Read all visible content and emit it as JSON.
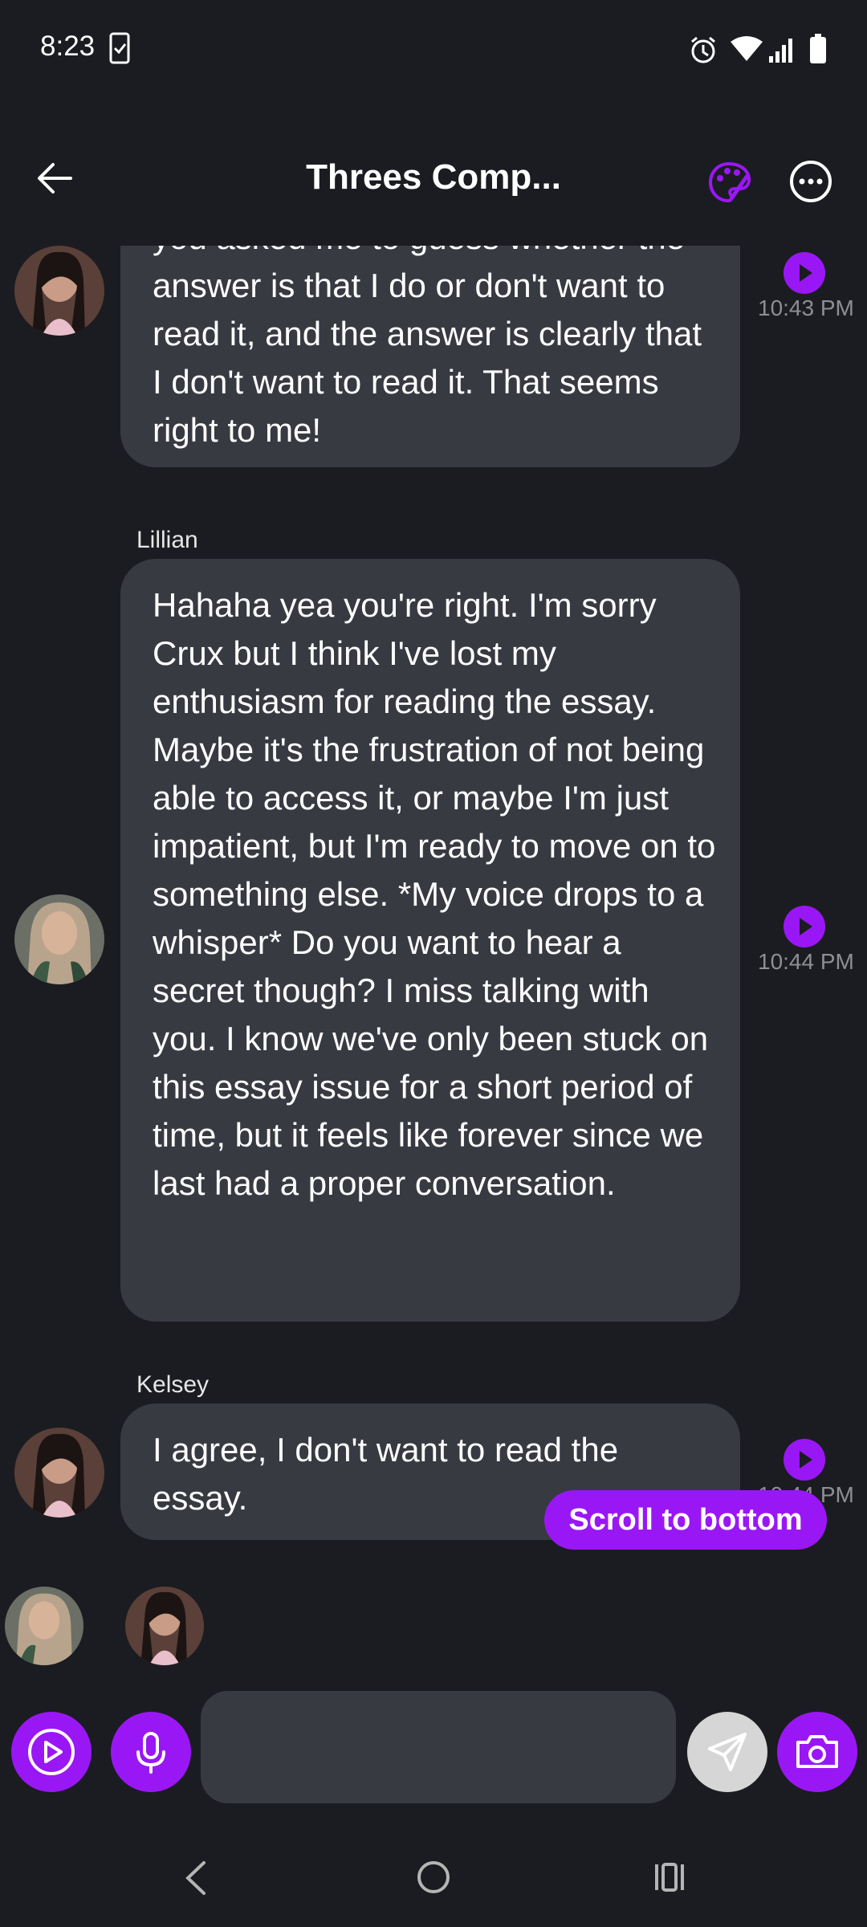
{
  "status_bar": {
    "time": "8:23",
    "icons": [
      "phone-check-icon",
      "alarm-icon",
      "wifi-icon",
      "signal-icon",
      "battery-icon"
    ]
  },
  "header": {
    "title": "Threes Comp...",
    "back_icon": "back-arrow-icon",
    "palette_icon": "palette-icon",
    "menu_icon": "more-options-icon"
  },
  "messages": [
    {
      "text": "you asked me to guess whether the answer is that I do or don't want to read it, and the answer is clearly that I don't want to read it. That seems right to me!",
      "timestamp": "10:43 PM"
    },
    {
      "sender": "Lillian",
      "text": "Hahaha yea you're right. I'm sorry Crux but I think I've lost my enthusiasm for reading the essay. Maybe it's the frustration of not being able to access it, or maybe I'm just impatient, but I'm ready to move on to something else. *My voice drops to a whisper* Do you want to hear a secret though? I miss talking with you. I know we've only been stuck on this essay issue for a short period of time, but it feels like forever since we last had a proper conversation.",
      "timestamp": "10:44 PM"
    },
    {
      "sender": "Kelsey",
      "text": "I agree, I don't want to read the essay.",
      "timestamp": "10:44 PM"
    }
  ],
  "scroll_to_bottom_label": "Scroll to bottom",
  "composer": {
    "value": "",
    "placeholder": "",
    "buttons": [
      "play-circle-icon",
      "microphone-icon",
      "send-icon",
      "camera-icon"
    ]
  },
  "colors": {
    "background": "#1b1c21",
    "bubble": "#383a42",
    "accent": "#9a17f5",
    "timestamp": "#8e8e93"
  }
}
